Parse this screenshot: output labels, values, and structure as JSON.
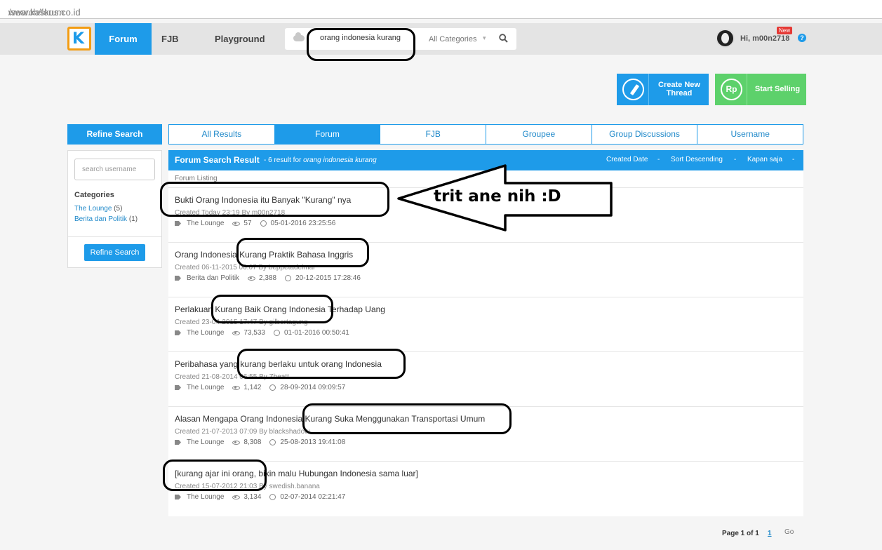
{
  "browser": {
    "url_host": "www.kaskus.co.id",
    "url_path": "/search/forum"
  },
  "nav": {
    "logo": "K",
    "forum": "Forum",
    "fjb": "FJB",
    "playground": "Playground"
  },
  "search": {
    "query": "orang indonesia kurang",
    "category": "All Categories",
    "caret": "▾"
  },
  "user": {
    "greeting": "Hi, m00n2718",
    "badge": "New",
    "help": "?"
  },
  "actions": {
    "create_line1": "Create New",
    "create_line2": "Thread",
    "sell": "Start Selling",
    "sell_icon": "Rp"
  },
  "sidebar": {
    "title": "Refine Search",
    "username_placeholder": "search username",
    "categories_title": "Categories",
    "categories": [
      {
        "name": "The Lounge",
        "count": "(5)"
      },
      {
        "name": "Berita dan Politik",
        "count": "(1)"
      }
    ],
    "button": "Refine Search"
  },
  "tabs": [
    "All Results",
    "Forum",
    "FJB",
    "Groupee",
    "Group Discussions",
    "Username"
  ],
  "active_tab": "Forum",
  "results": {
    "title": "Forum Search Result",
    "summary_prefix": " - 6 result for ",
    "summary_query": "orang indonesia kurang",
    "sort_date": "Created Date",
    "sort_order": "Sort Descending",
    "sort_time": "Kapan saja",
    "dash": "-",
    "listing_label": "Forum Listing"
  },
  "threads": [
    {
      "title": "Bukti Orang Indonesia itu Banyak \"Kurang\" nya",
      "meta": "Created Today 23:19 By m00n2718",
      "category": "The Lounge",
      "views": "57",
      "last": "05-01-2016 23:25:56"
    },
    {
      "title": "Orang Indonesia Kurang Praktik Bahasa Inggris",
      "meta": "Created 06-11-2015 06:07 By beppetadelmar",
      "category": "Berita dan Politik",
      "views": "2,388",
      "last": "20-12-2015 17:28:46"
    },
    {
      "title": "Perlakuan Kurang Baik Orang Indonesia Terhadap Uang",
      "meta": "Created 23-04-2015 17:47 By gilbertagung",
      "category": "The Lounge",
      "views": "73,533",
      "last": "01-01-2016 00:50:41"
    },
    {
      "title": "Peribahasa yang kurang berlaku untuk orang Indonesia",
      "meta": "Created 21-08-2014 06:55 By Zbeatt",
      "category": "The Lounge",
      "views": "1,142",
      "last": "28-09-2014 09:09:57"
    },
    {
      "title": "Alasan Mengapa Orang Indonesia Kurang Suka Menggunakan Transportasi Umum",
      "meta": "Created 21-07-2013 07:09 By blackshadow",
      "category": "The Lounge",
      "views": "8,308",
      "last": "25-08-2013 19:41:08"
    },
    {
      "title": "[kurang ajar ini orang, bikin malu Hubungan Indonesia sama luar]",
      "meta": "Created 15-07-2012 21:03 By swedish.banana",
      "category": "The Lounge",
      "views": "3,134",
      "last": "02-07-2014 02:21:47"
    }
  ],
  "annotation": {
    "text": "trit ane nih :D"
  },
  "pager": {
    "label": "Page 1 of 1",
    "current": "1",
    "go": "Go"
  },
  "colors": {
    "brand_blue": "#1e9be9",
    "sell_green": "#5dd16b",
    "logo_orange": "#f39c12"
  }
}
